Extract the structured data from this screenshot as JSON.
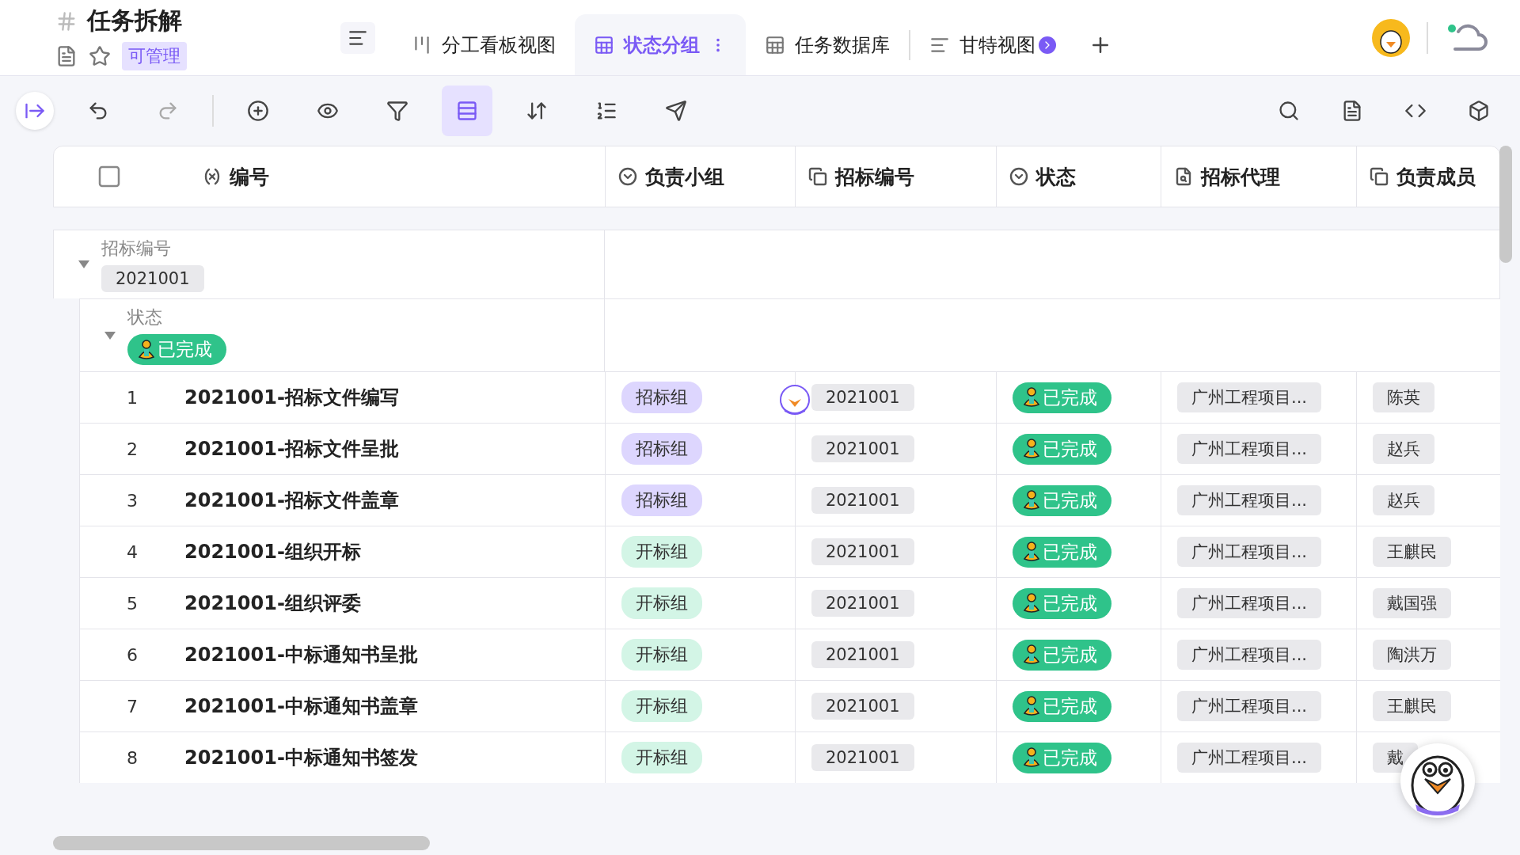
{
  "header": {
    "title": "任务拆解",
    "permission": "可管理"
  },
  "tabs": [
    {
      "label": "分工看板视图",
      "kind": "kanban",
      "selected": false
    },
    {
      "label": "状态分组",
      "kind": "grid",
      "selected": true
    },
    {
      "label": "任务数据库",
      "kind": "grid",
      "selected": false
    },
    {
      "label": "甘特视图",
      "kind": "gantt",
      "selected": false
    }
  ],
  "toolbar": {
    "buttons": [
      {
        "kind": "add",
        "selected": false
      },
      {
        "kind": "view",
        "selected": false
      },
      {
        "kind": "filter",
        "selected": false
      },
      {
        "kind": "group",
        "selected": true
      },
      {
        "kind": "sort",
        "selected": false
      },
      {
        "kind": "row_height",
        "selected": false
      },
      {
        "kind": "share",
        "selected": false
      }
    ]
  },
  "table": {
    "select_all_checked": false,
    "columns": [
      {
        "label": "编号",
        "kind": "formula"
      },
      {
        "label": "负责小组",
        "kind": "select"
      },
      {
        "label": "招标编号",
        "kind": "link"
      },
      {
        "label": "状态",
        "kind": "select"
      },
      {
        "label": "招标代理",
        "kind": "lookup"
      },
      {
        "label": "负责成员",
        "kind": "link"
      }
    ],
    "group": {
      "field": "招标编号",
      "value": "2021001",
      "expanded": true,
      "subgroup": {
        "field": "状态",
        "value": "已完成",
        "expanded": true,
        "rows": [
          {
            "no": "1",
            "title": "2021001-招标文件编写",
            "team": "招标组",
            "color": "#ddd6fe",
            "bid": "2021001",
            "status": "已完成",
            "agent": "广州工程项目...",
            "member": "陈英",
            "collaborator": true
          },
          {
            "no": "2",
            "title": "2021001-招标文件呈批",
            "team": "招标组",
            "color": "#ddd6fe",
            "bid": "2021001",
            "status": "已完成",
            "agent": "广州工程项目...",
            "member": "赵兵",
            "collaborator": false
          },
          {
            "no": "3",
            "title": "2021001-招标文件盖章",
            "team": "招标组",
            "color": "#ddd6fe",
            "bid": "2021001",
            "status": "已完成",
            "agent": "广州工程项目...",
            "member": "赵兵",
            "collaborator": false
          },
          {
            "no": "4",
            "title": "2021001-组织开标",
            "team": "开标组",
            "color": "#d3f5e6",
            "bid": "2021001",
            "status": "已完成",
            "agent": "广州工程项目...",
            "member": "王麒民",
            "collaborator": false
          },
          {
            "no": "5",
            "title": "2021001-组织评委",
            "team": "开标组",
            "color": "#d3f5e6",
            "bid": "2021001",
            "status": "已完成",
            "agent": "广州工程项目...",
            "member": "戴国强",
            "collaborator": false
          },
          {
            "no": "6",
            "title": "2021001-中标通知书呈批",
            "team": "开标组",
            "color": "#d3f5e6",
            "bid": "2021001",
            "status": "已完成",
            "agent": "广州工程项目...",
            "member": "陶洪万",
            "collaborator": false
          },
          {
            "no": "7",
            "title": "2021001-中标通知书盖章",
            "team": "开标组",
            "color": "#d3f5e6",
            "bid": "2021001",
            "status": "已完成",
            "agent": "广州工程项目...",
            "member": "王麒民",
            "collaborator": false
          },
          {
            "no": "8",
            "title": "2021001-中标通知书签发",
            "team": "开标组",
            "color": "#d3f5e6",
            "bid": "2021001",
            "status": "已完成",
            "agent": "广州工程项目...",
            "member": "戴",
            "collaborator": false
          }
        ]
      }
    }
  }
}
